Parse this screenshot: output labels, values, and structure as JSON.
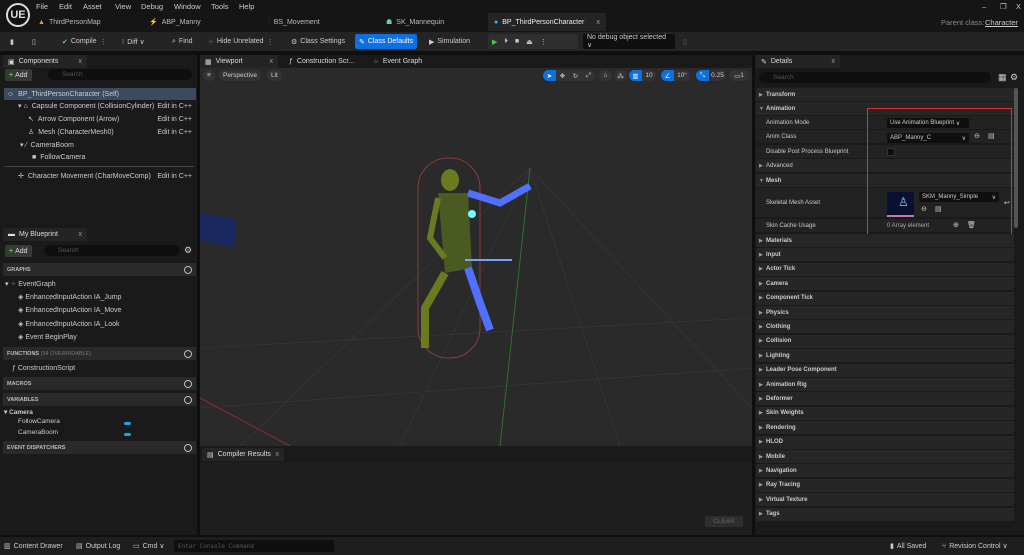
{
  "app": {
    "logo": "UE",
    "menu": [
      "File",
      "Edit",
      "Asset",
      "View",
      "Debug",
      "Window",
      "Tools",
      "Help"
    ],
    "window_controls": [
      "–",
      "❐",
      "X"
    ],
    "tabs": [
      {
        "label": "ThirdPersonMap",
        "icon": "level-icon"
      },
      {
        "label": "ABP_Manny",
        "icon": "anim-blueprint-icon"
      },
      {
        "label": "BS_Movement",
        "icon": "blendspace-icon"
      },
      {
        "label": "SK_Mannequin",
        "icon": "skeleton-icon"
      },
      {
        "label": "BP_ThirdPersonCharacter",
        "icon": "blueprint-icon",
        "active": true,
        "close": "x"
      }
    ],
    "parent_class_label": "Parent class:",
    "parent_class": "Character"
  },
  "toolbar": {
    "compile": "Compile",
    "diff": "Diff ∨",
    "find": "Find",
    "hide_unrelated": "Hide Unrelated",
    "class_settings": "Class Settings",
    "class_defaults": "Class Defaults",
    "simulation": "Simulation",
    "debug_object": "No debug object selected ∨",
    "accent": "#0e70e0"
  },
  "components": {
    "tab": "Components",
    "close": "x",
    "add": "Add",
    "search_placeholder": "Search",
    "items": [
      {
        "label": "BP_ThirdPersonCharacter (Self)",
        "selected": true
      },
      {
        "label": "Capsule Component (CollisionCylinder)",
        "edit": "Edit in C++"
      },
      {
        "label": "Arrow Component (Arrow)",
        "edit": "Edit in C++"
      },
      {
        "label": "Mesh (CharacterMesh0)",
        "edit": "Edit in C++"
      },
      {
        "label": "CameraBoom"
      },
      {
        "label": "FollowCamera"
      },
      {
        "label": "Character Movement (CharMoveComp)",
        "edit": "Edit in C++"
      }
    ]
  },
  "my_blueprint": {
    "tab": "My Blueprint",
    "close": "x",
    "add": "Add",
    "search_placeholder": "Search",
    "graphs_header": "GRAPHS",
    "event_graph": "EventGraph",
    "events": [
      "EnhancedInputAction IA_Jump",
      "EnhancedInputAction IA_Move",
      "EnhancedInputAction IA_Look",
      "Event BeginPlay"
    ],
    "functions_header": "FUNCTIONS",
    "functions_count": "(34 OVERRIDABLE)",
    "functions": [
      "ConstructionScript"
    ],
    "macros_header": "MACROS",
    "variables_header": "VARIABLES",
    "var_category": "Camera",
    "variables": [
      "FollowCamera",
      "CameraBoom"
    ],
    "variable_color": "#12a8e8",
    "dispatchers_header": "EVENT DISPATCHERS"
  },
  "viewport": {
    "tabs": [
      "Viewport",
      "Construction Scr...",
      "Event Graph"
    ],
    "close": "x",
    "perspective": "Perspective",
    "lit": "Lit",
    "grid_snap": "10",
    "rotation_snap": "10°",
    "scale_snap": "0.25",
    "camera_speed": "1"
  },
  "compiler": {
    "tab": "Compiler Results",
    "close": "x",
    "clear": "CLEAR"
  },
  "details": {
    "tab": "Details",
    "close": "x",
    "search_placeholder": "Search",
    "transform": "Transform",
    "animation": "Animation",
    "anim_mode_label": "Animation Mode",
    "anim_mode": "Use Animation Blueprint",
    "anim_class_label": "Anim Class",
    "anim_class": "ABP_Manny_C",
    "disable_pp_label": "Disable Post Process Blueprint",
    "disable_pp_checked": false,
    "advanced": "Advanced",
    "mesh": "Mesh",
    "skeletal_mesh_label": "Skeletal Mesh Asset",
    "skeletal_mesh": "SKM_Manny_Simple",
    "skin_cache_label": "Skin Cache Usage",
    "skin_cache": "0 Array element",
    "categories": [
      "Materials",
      "Input",
      "Actor Tick",
      "Camera",
      "Component Tick",
      "Physics",
      "Clothing",
      "Collision",
      "Lighting",
      "Leader Pose Component",
      "Animation Rig",
      "Deformer",
      "Skin Weights",
      "Rendering",
      "HLOD",
      "Mobile",
      "Navigation",
      "Ray Tracing",
      "Virtual Texture",
      "Tags"
    ],
    "highlight_color": "#e03030"
  },
  "status": {
    "content_drawer": "Content Drawer",
    "output_log": "Output Log",
    "cmd": "Cmd ∨",
    "console_placeholder": "Enter Console Command",
    "all_saved": "All Saved",
    "revision_control": "Revision Control ∨"
  }
}
